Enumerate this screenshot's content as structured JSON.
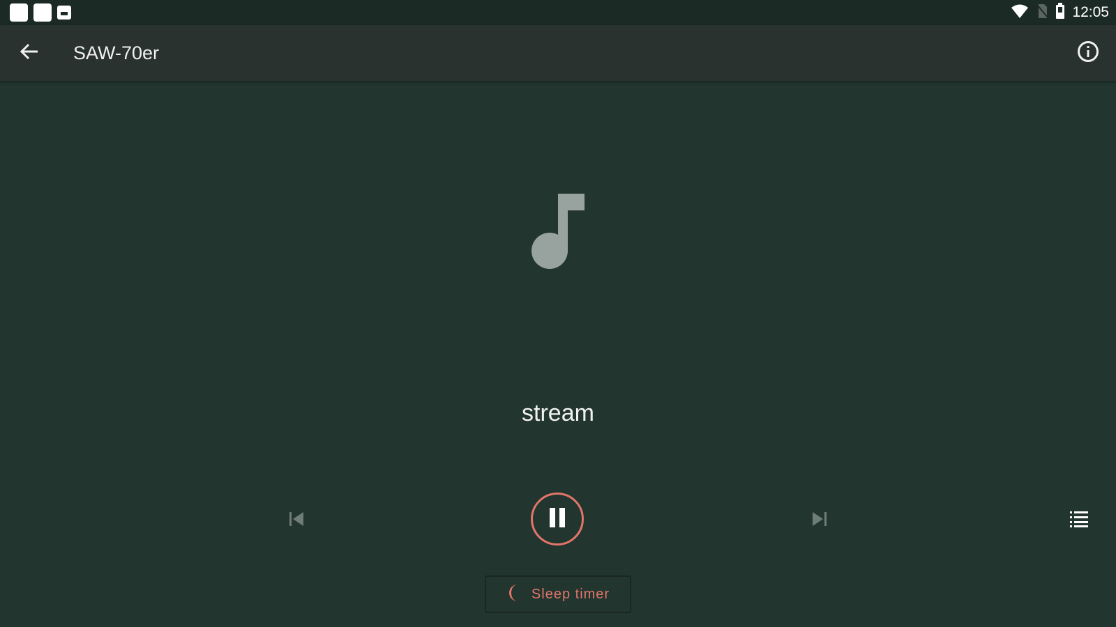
{
  "status_bar": {
    "time": "12:05",
    "notification_icons": [
      "app-notification-icon",
      "app-notification-icon",
      "image-notification-icon"
    ],
    "icons": [
      "wifi-icon",
      "no-sim-icon",
      "battery-icon"
    ]
  },
  "app_bar": {
    "title": "SAW-70er",
    "back_icon": "back-arrow-icon",
    "info_icon": "info-icon"
  },
  "player": {
    "artwork_icon": "music-note-icon",
    "track_title": "stream",
    "controls": [
      "skip-previous-icon",
      "pause-icon",
      "skip-next-icon",
      "queue-list-icon"
    ],
    "sleep_timer_label": "Sleep timer"
  },
  "colors": {
    "background": "#22352f",
    "app_bar": "#2a3230",
    "status_bar": "#1c2a25",
    "accent": "#e2766a",
    "artwork": "#98a3a0",
    "disabled_control": "#6f7c78"
  }
}
